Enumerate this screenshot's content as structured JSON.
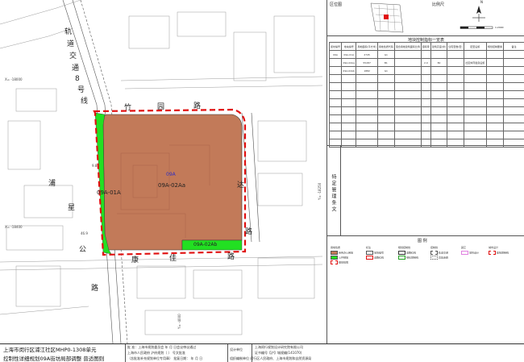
{
  "map": {
    "road_labels": {
      "rail_line": [
        "轨",
        "道",
        "交",
        "通",
        "8",
        "号",
        "线"
      ],
      "pu_xing_road": [
        "浦",
        "星",
        "公",
        "路"
      ],
      "north_road": [
        "竹",
        "园",
        "路"
      ],
      "east_road": [
        "达",
        "路"
      ],
      "south_road": [
        "康",
        "佳",
        "路"
      ]
    },
    "parcels": {
      "main": "09A-02Aa",
      "west": "09A-01A",
      "south_east": "09A-02Ab",
      "block": "09A"
    },
    "coordinates": {
      "x1": "X= -18000",
      "x2": "X= -18400",
      "y1": "Y= -4000",
      "y2": "Y= -18250"
    },
    "dimensions": [
      "46.9",
      "9.8"
    ]
  },
  "panel": {
    "location_map_label": "区位图",
    "scale_label": "比例尺",
    "north_label": "N",
    "scale_value": "1:2000",
    "control_table_title": "地块控制指标一览表",
    "control_table_headers": [
      "街坊编号",
      "地块编号",
      "用地面积(平方米)",
      "用地性质代码",
      "混合用地建筑面积比例",
      "容积率",
      "建筑高度(米)",
      "住宅套数(套)",
      "配套设施",
      "规划控制要素",
      "备注"
    ],
    "control_table_rows": [
      [
        "09A",
        "09A-01A",
        "2745",
        "G1",
        "",
        "",
        "",
        "",
        "",
        "",
        ""
      ],
      [
        "",
        "09A-02Aa",
        "55287",
        "B1",
        "",
        "2.0",
        "80",
        "",
        "社区体育健身设施",
        "",
        ""
      ],
      [
        "",
        "09A-02Ab",
        "1882",
        "G1",
        "",
        "",
        "",
        "",
        "",
        "",
        ""
      ]
    ],
    "special_title": "特定管理条文",
    "legend_title": "图 例",
    "legend_groups": [
      {
        "head": "用地性质",
        "items": [
          "商务办公用地",
          "公共绿地",
          "规划范围"
        ]
      },
      {
        "head": "标注",
        "items": [
          "地块编号",
          "道路红线"
        ]
      },
      {
        "head": "规划控制线",
        "items": [
          "道路红线",
          "绿化控制线"
        ]
      },
      {
        "head": "控制线",
        "items": [
          "轨道交通",
          "高压走廊"
        ]
      },
      {
        "head": "其它",
        "items": [
          "城市设计"
        ]
      },
      {
        "head": "城市设计",
        "items": [
          "建筑控制线"
        ]
      }
    ]
  },
  "titleblock": {
    "title1": "上海市闵行区浦江社区MHP0-1308单元",
    "title2": "控制性详细规划09A街坊局部调整  普适图则",
    "approval1": "批  准：上海市规划委员会      年      月      日会议审议通过",
    "approval2": "上海市人民政府        沪府规划〔    〕    号文批准",
    "approval3": "（含批准补充规划单位专用章）  批复日期：    年    月    日",
    "designer_label": "设计单位",
    "designer": "上海闵行规划设计研究院有限公司",
    "cert": "证书编号【沪】城规编(141070)",
    "organizer": "组织编制单位 闵行区人民政府、上海市规划和自然资源局"
  },
  "colors": {
    "commercial": "#c27a59",
    "green": "#22e022",
    "red_line": "#e01010"
  }
}
